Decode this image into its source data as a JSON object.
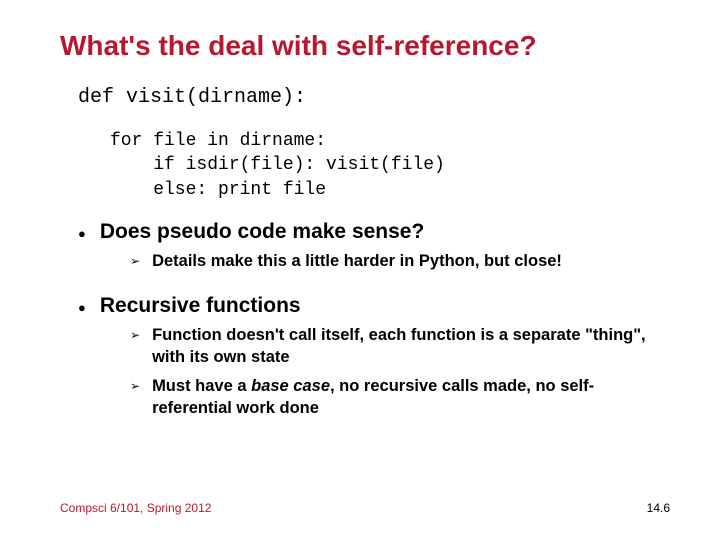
{
  "title": "What's the deal with self-reference?",
  "code": {
    "def_line": "def visit(dirname):",
    "body": "for file in dirname:\n    if isdir(file): visit(file)\n    else: print file"
  },
  "bullets": [
    {
      "text": "Does pseudo code make sense?",
      "subs": [
        {
          "text": "Details make this a little harder in Python, but close!"
        }
      ]
    },
    {
      "text": "Recursive functions",
      "subs": [
        {
          "text": "Function doesn't call itself, each function is a separate \"thing\", with its own state"
        },
        {
          "prefix": "Must have a ",
          "italic": "base case",
          "suffix": ", no recursive calls made, no self-referential work done"
        }
      ]
    }
  ],
  "footer": {
    "left": "Compsci 6/101, Spring 2012",
    "right": "14.6"
  }
}
